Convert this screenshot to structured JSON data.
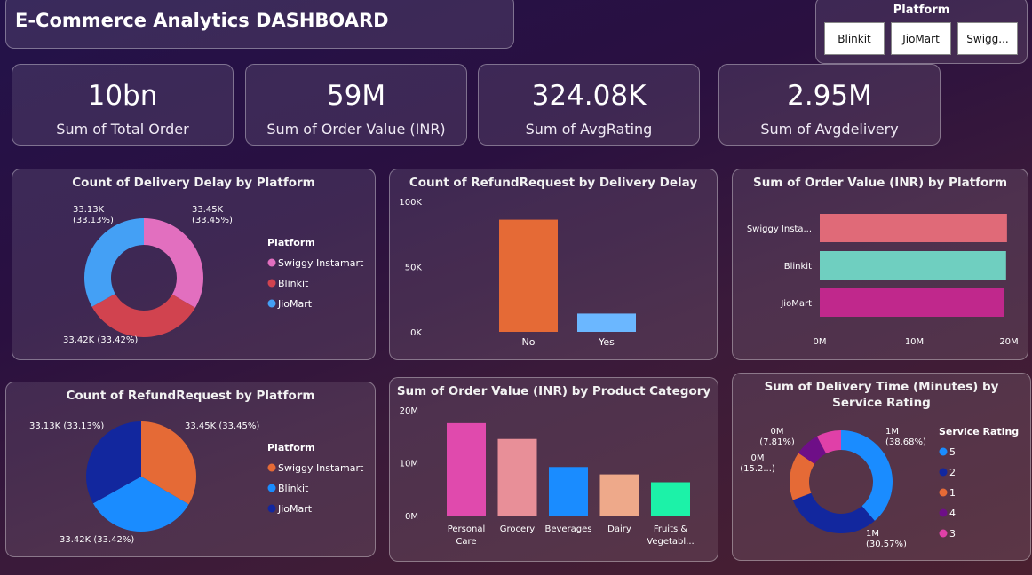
{
  "header": {
    "title": "E-Commerce Analytics DASHBOARD"
  },
  "filter": {
    "title": "Platform",
    "buttons": [
      "Blinkit",
      "JioMart",
      "Swigg..."
    ]
  },
  "kpis": [
    {
      "value": "10bn",
      "label": "Sum of Total Order"
    },
    {
      "value": "59M",
      "label": "Sum of Order Value (INR)"
    },
    {
      "value": "324.08K",
      "label": "Sum of AvgRating"
    },
    {
      "value": "2.95M",
      "label": "Sum of Avgdelivery"
    }
  ],
  "colors": {
    "swiggy_pink": "#e26fbf",
    "blinkit_red": "#d1434f",
    "jiomart_blue": "#44a0f5",
    "orange": "#e56a36",
    "light_blue": "#6bb7ff",
    "royal_blue": "#1a8cff",
    "navy": "#12279e",
    "purple": "#6e0f87",
    "magenta": "#e040a8"
  },
  "chart_data": [
    {
      "type": "pie",
      "title": "Count of Delivery Delay by Platform",
      "legend_title": "Platform",
      "legend_position": "right",
      "donut": true,
      "slices": [
        {
          "name": "Swiggy Instamart",
          "value": 33.45,
          "label": "33.45K",
          "pct": "(33.45%)",
          "color": "#e26fbf"
        },
        {
          "name": "Blinkit",
          "value": 33.42,
          "label": "33.42K",
          "pct": "(33.42%)",
          "color": "#d1434f"
        },
        {
          "name": "JioMart",
          "value": 33.13,
          "label": "33.13K",
          "pct": "(33.13%)",
          "color": "#44a0f5"
        }
      ]
    },
    {
      "type": "bar",
      "title": "Count of RefundRequest by Delivery Delay",
      "categories": [
        "No",
        "Yes"
      ],
      "values": [
        86000,
        14000
      ],
      "colors": [
        "#e56a36",
        "#6bb7ff"
      ],
      "ylim": [
        0,
        100000
      ],
      "yticks": [
        "0K",
        "50K",
        "100K"
      ],
      "ytick_values": [
        0,
        50000,
        100000
      ],
      "grid": false
    },
    {
      "type": "bar",
      "orientation": "horizontal",
      "title": "Sum of Order Value (INR) by Platform",
      "categories": [
        "Swiggy Insta...",
        "Blinkit",
        "JioMart"
      ],
      "values": [
        19.8,
        19.7,
        19.5
      ],
      "colors": [
        "#e06a78",
        "#6fcfc0",
        "#c0288c"
      ],
      "xlim": [
        0,
        20
      ],
      "xticks": [
        "0M",
        "10M",
        "20M"
      ],
      "xtick_values": [
        0,
        10,
        20
      ],
      "grid": false
    },
    {
      "type": "pie",
      "title": "Count of RefundRequest by Platform",
      "legend_title": "Platform",
      "legend_position": "right",
      "donut": false,
      "slices": [
        {
          "name": "Swiggy Instamart",
          "value": 33.45,
          "label": "33.45K (33.45%)",
          "color": "#e56a36"
        },
        {
          "name": "Blinkit",
          "value": 33.42,
          "label": "33.42K (33.42%)",
          "color": "#1a8cff"
        },
        {
          "name": "JioMart",
          "value": 33.13,
          "label": "33.13K (33.13%)",
          "color": "#12279e"
        }
      ]
    },
    {
      "type": "bar",
      "title": "Sum of Order Value (INR) by Product Category",
      "categories": [
        "Personal Care",
        "Grocery",
        "Beverages",
        "Dairy",
        "Fruits & Vegetabl..."
      ],
      "category_lines": [
        [
          "Personal",
          "Care"
        ],
        [
          "Grocery"
        ],
        [
          "Beverages"
        ],
        [
          "Dairy"
        ],
        [
          "Fruits &",
          "Vegetabl..."
        ]
      ],
      "values": [
        17.5,
        14.5,
        9.2,
        7.8,
        6.3
      ],
      "colors": [
        "#e04aad",
        "#e88f98",
        "#1a8cff",
        "#eea98a",
        "#1cf2a8"
      ],
      "ylim": [
        0,
        20
      ],
      "yticks": [
        "0M",
        "10M",
        "20M"
      ],
      "ytick_values": [
        0,
        10,
        20
      ],
      "grid": false
    },
    {
      "type": "pie",
      "title": "Sum of Delivery Time (Minutes) by Service Rating",
      "legend_title": "Service Rating",
      "legend_position": "right",
      "donut": true,
      "slices": [
        {
          "name": "5",
          "value": 38.68,
          "label": "1M",
          "pct": "(38.68%)",
          "color": "#1a8cff"
        },
        {
          "name": "2",
          "value": 30.57,
          "label": "1M",
          "pct": "(30.57%)",
          "color": "#12279e"
        },
        {
          "name": "1",
          "value": 15.2,
          "label": "0M",
          "pct": "(15.2...)",
          "color": "#e56a36"
        },
        {
          "name": "4",
          "value": 7.81,
          "label": "0M",
          "pct": "(7.81%)",
          "color": "#6e0f87"
        },
        {
          "name": "3",
          "value": 7.74,
          "label": "",
          "pct": "",
          "color": "#e040a8"
        }
      ]
    }
  ]
}
